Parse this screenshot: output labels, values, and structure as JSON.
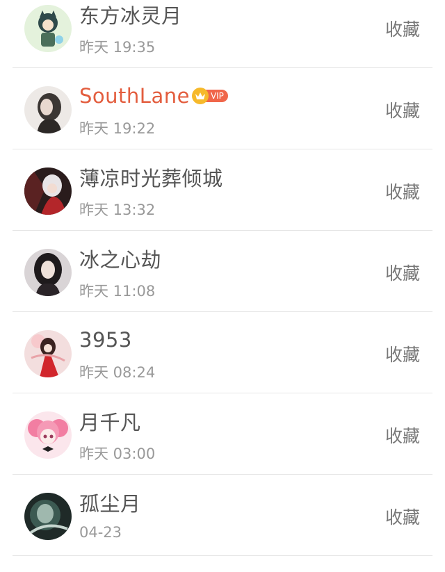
{
  "contacts": [
    {
      "name": "东方冰灵月",
      "time": "昨天 19:35",
      "action": "收藏",
      "vip": false
    },
    {
      "name": "SouthLane",
      "time": "昨天 19:22",
      "action": "收藏",
      "vip": true,
      "vip_label": "VIP"
    },
    {
      "name": "薄凉时光葬倾城",
      "time": "昨天 13:32",
      "action": "收藏",
      "vip": false
    },
    {
      "name": "冰之心劫",
      "time": "昨天 11:08",
      "action": "收藏",
      "vip": false
    },
    {
      "name": "3953",
      "time": "昨天 08:24",
      "action": "收藏",
      "vip": false
    },
    {
      "name": "月千凡",
      "time": "昨天 03:00",
      "action": "收藏",
      "vip": false
    },
    {
      "name": "孤尘月",
      "time": "04-23",
      "action": "收藏",
      "vip": false
    }
  ],
  "colors": {
    "vip_name": "#e35d3e",
    "vip_badge": "#f0664a",
    "crown": "#f6b92b"
  },
  "icons": {
    "crown": "crown-icon"
  }
}
